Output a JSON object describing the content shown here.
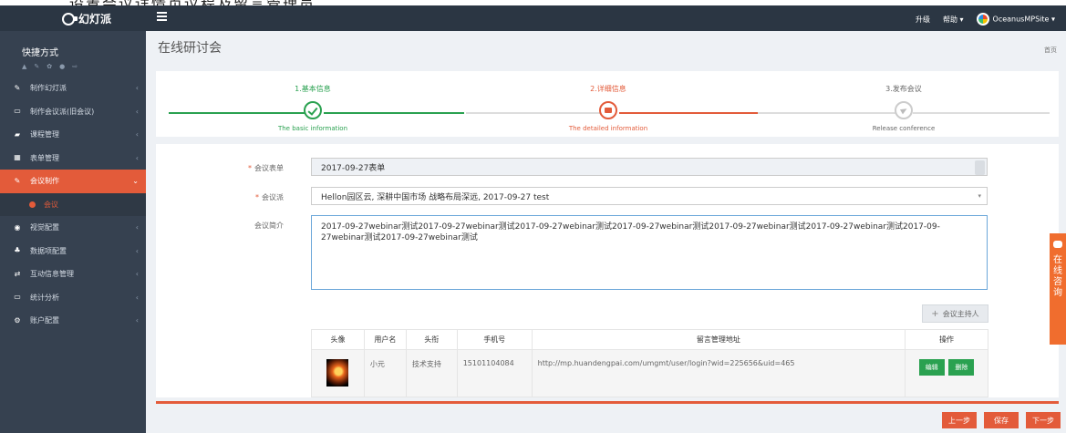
{
  "app": {
    "logo_text": "幻灯派",
    "top_caption": "二、设置会议详情页议程及留言管理员"
  },
  "header": {
    "upgrade": "升级",
    "help": "帮助 ▾",
    "site": "OceanusMPSite ▾"
  },
  "sidebar": {
    "shortcuts_title": "快捷方式",
    "shortcut_icons": [
      "▲",
      "✎",
      "✿",
      "●",
      "⇨"
    ],
    "items": [
      {
        "label": "制作幻灯派",
        "icon": "✎",
        "chev": "‹"
      },
      {
        "label": "制作会议派(旧会议)",
        "icon": "▭",
        "chev": "‹"
      },
      {
        "label": "课程管理",
        "icon": "▰",
        "chev": "‹"
      },
      {
        "label": "表单管理",
        "icon": "▦",
        "chev": "‹"
      },
      {
        "label": "会议制作",
        "icon": "✎",
        "chev": "⌄"
      },
      {
        "label": "会议",
        "icon": ""
      },
      {
        "label": "视觉配置",
        "icon": "◉",
        "chev": "‹"
      },
      {
        "label": "数据项配置",
        "icon": "♣",
        "chev": "‹"
      },
      {
        "label": "互动信息管理",
        "icon": "⇄",
        "chev": "‹"
      },
      {
        "label": "统计分析",
        "icon": "▭",
        "chev": "‹"
      },
      {
        "label": "账户配置",
        "icon": "⚙",
        "chev": "‹"
      }
    ]
  },
  "main": {
    "page_title": "在线研讨会",
    "breadcrumb": "首页"
  },
  "steps": [
    {
      "label": "1.基本信息",
      "sub": "The basic information"
    },
    {
      "label": "2.详细信息",
      "sub": "The detailed information"
    },
    {
      "label": "3.发布会议",
      "sub": "Release conference"
    }
  ],
  "form": {
    "form_label": "会议表单",
    "form_value": "2017-09-27表单",
    "group_label": "会议派",
    "group_value": "Hellon园区云, 深耕中国市场 战略布局深远, 2017-09-27 test",
    "intro_label": "会议简介",
    "intro_value": "2017-09-27webinar测试2017-09-27webinar测试2017-09-27webinar测试2017-09-27webinar测试2017-09-27webinar测试2017-09-27webinar测试2017-09-27webinar测试2017-09-27webinar测试",
    "host_button": "会议主持人",
    "host_plus": "+"
  },
  "hosts_table": {
    "headers": [
      "头像",
      "用户名",
      "头衔",
      "手机号",
      "留言管理地址",
      "操作"
    ],
    "rows": [
      {
        "username": "小元",
        "title": "技术支持",
        "phone": "15101104084",
        "url": "http://mp.huandengpai.com/umgmt/user/login?wid=225656&uid=465",
        "edit": "编辑",
        "delete": "删除"
      }
    ]
  },
  "footer": {
    "prev": "上一步",
    "save": "保存",
    "next": "下一步"
  },
  "chat_tab": {
    "chars": [
      "在",
      "线",
      "咨",
      "询"
    ]
  },
  "colors": {
    "accent": "#e35b3a",
    "success": "#2aa150",
    "sidebar": "#364150",
    "header": "#2b3643"
  }
}
